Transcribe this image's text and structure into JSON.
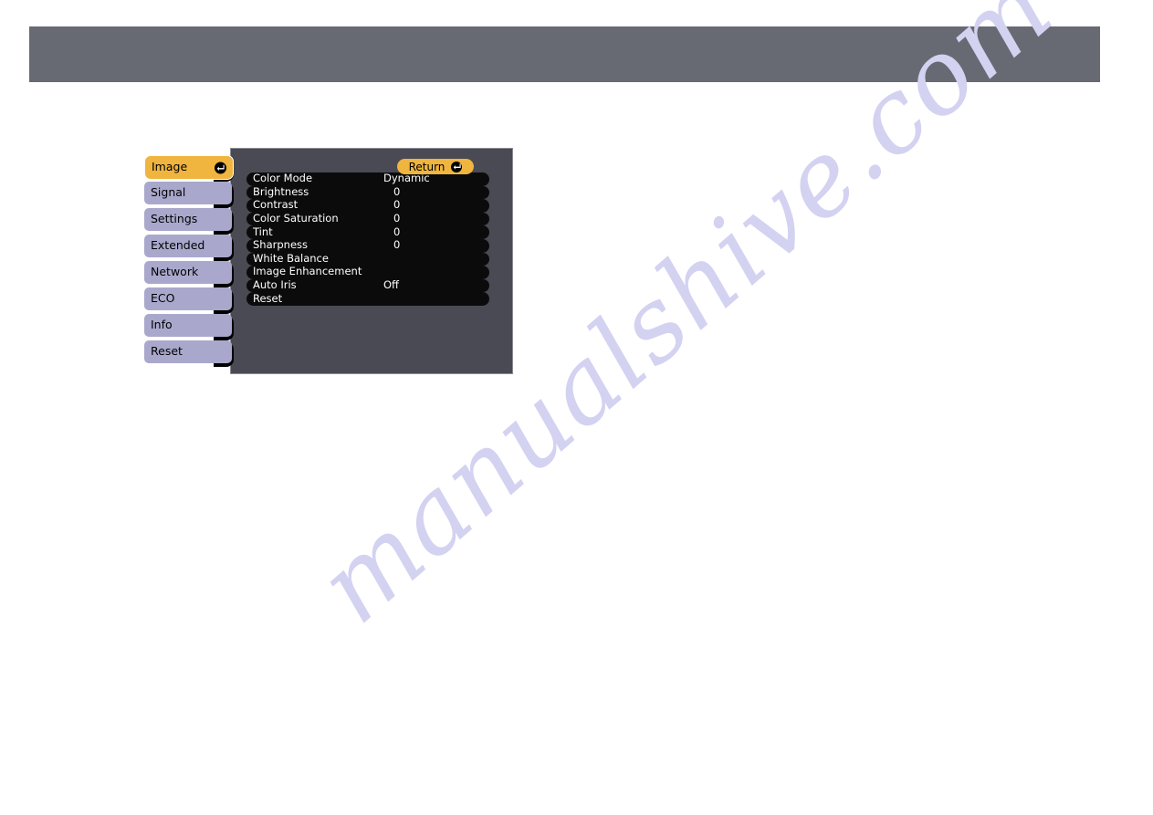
{
  "header": {
    "band_color": "#676a72"
  },
  "watermark": {
    "text": "manualshive.com",
    "color": "#d3d2f1"
  },
  "osd": {
    "panel_color": "#494a54",
    "accent_color": "#f0b53f",
    "tab_color": "#a9a8cc",
    "items_panel_color": "#0b0b0b",
    "sidebar": {
      "items": [
        {
          "label": "Image",
          "active": true,
          "enter_icon": "enter-key-icon"
        },
        {
          "label": "Signal",
          "active": false,
          "enter_icon": ""
        },
        {
          "label": "Settings",
          "active": false,
          "enter_icon": ""
        },
        {
          "label": "Extended",
          "active": false,
          "enter_icon": ""
        },
        {
          "label": "Network",
          "active": false,
          "enter_icon": ""
        },
        {
          "label": "ECO",
          "active": false,
          "enter_icon": ""
        },
        {
          "label": "Info",
          "active": false,
          "enter_icon": ""
        },
        {
          "label": "Reset",
          "active": false,
          "enter_icon": ""
        }
      ]
    },
    "return_button": {
      "label": "Return",
      "icon": "enter-key-icon"
    },
    "menu": {
      "rows": [
        {
          "name": "Color Mode",
          "value": "Dynamic",
          "numeric": false
        },
        {
          "name": "Brightness",
          "value": "0",
          "numeric": true
        },
        {
          "name": "Contrast",
          "value": "0",
          "numeric": true
        },
        {
          "name": "Color Saturation",
          "value": "0",
          "numeric": true
        },
        {
          "name": "Tint",
          "value": "0",
          "numeric": true
        },
        {
          "name": "Sharpness",
          "value": "0",
          "numeric": true
        },
        {
          "name": "White Balance",
          "value": "",
          "numeric": false
        },
        {
          "name": "Image Enhancement",
          "value": "",
          "numeric": false
        },
        {
          "name": "Auto Iris",
          "value": "Off",
          "numeric": false
        },
        {
          "name": "Reset",
          "value": "",
          "numeric": false
        }
      ]
    }
  }
}
